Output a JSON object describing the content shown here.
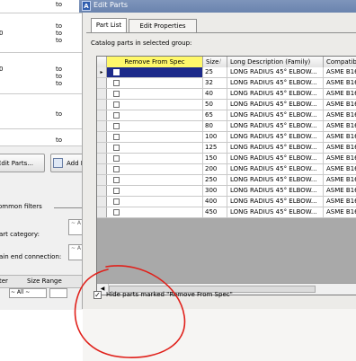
{
  "left_panel": {
    "rows": [
      {
        "num": "",
        "to": [
          "to"
        ]
      },
      {
        "num": "0",
        "to": [
          "to",
          "to",
          "to"
        ]
      },
      {
        "num": "0",
        "to": [
          "to",
          "to",
          "to"
        ]
      },
      {
        "num": "",
        "to": [
          "to"
        ]
      },
      {
        "num": "",
        "to": [
          "to"
        ]
      }
    ],
    "edit_parts_label": "Edit Parts...",
    "add_label": "Add I",
    "common_filters_label": "ommon filters",
    "part_category_label": "art category:",
    "main_end_connection_label": "ain end connection:",
    "combo_value": "~ A",
    "col_ter": "ter",
    "col_size_range": "Size Range",
    "select_all_1": "~ All ~",
    "select_all_2": ""
  },
  "dialog": {
    "title": "Edit Parts",
    "app_icon_letter": "A",
    "tabs": [
      {
        "label": "Part List",
        "active": true
      },
      {
        "label": "Edit Properties",
        "active": false
      }
    ],
    "catalog_label": "Catalog parts in selected group:",
    "grid": {
      "headers": {
        "remove": "Remove From Spec",
        "size": "Size",
        "long_description": "Long Description (Family)",
        "compatible": "Compatible"
      },
      "sort_mark": "/",
      "row_pointer": "▸",
      "rows": [
        {
          "size": "25",
          "description": "LONG RADIUS 45° ELBOW...",
          "compatible": "ASME B16."
        },
        {
          "size": "32",
          "description": "LONG RADIUS 45° ELBOW...",
          "compatible": "ASME B16."
        },
        {
          "size": "40",
          "description": "LONG RADIUS 45° ELBOW...",
          "compatible": "ASME B16."
        },
        {
          "size": "50",
          "description": "LONG RADIUS 45° ELBOW...",
          "compatible": "ASME B16."
        },
        {
          "size": "65",
          "description": "LONG RADIUS 45° ELBOW...",
          "compatible": "ASME B16."
        },
        {
          "size": "80",
          "description": "LONG RADIUS 45° ELBOW...",
          "compatible": "ASME B16."
        },
        {
          "size": "100",
          "description": "LONG RADIUS 45° ELBOW...",
          "compatible": "ASME B16."
        },
        {
          "size": "125",
          "description": "LONG RADIUS 45° ELBOW...",
          "compatible": "ASME B16."
        },
        {
          "size": "150",
          "description": "LONG RADIUS 45° ELBOW...",
          "compatible": "ASME B16."
        },
        {
          "size": "200",
          "description": "LONG RADIUS 45° ELBOW...",
          "compatible": "ASME B16."
        },
        {
          "size": "250",
          "description": "LONG RADIUS 45° ELBOW...",
          "compatible": "ASME B16."
        },
        {
          "size": "300",
          "description": "LONG RADIUS 45° ELBOW...",
          "compatible": "ASME B16."
        },
        {
          "size": "400",
          "description": "LONG RADIUS 45° ELBOW...",
          "compatible": "ASME B16."
        },
        {
          "size": "450",
          "description": "LONG RADIUS 45° ELBOW...",
          "compatible": "ASME B16."
        }
      ]
    },
    "hide_checkbox": {
      "checked": true,
      "check_glyph": "✓",
      "label": "Hide parts marked \"Remove From Spec\""
    }
  },
  "colors": {
    "header_highlight": "#fff86a",
    "annotation_ink": "#e0201a",
    "selected_cell": "#1c2a8a"
  }
}
